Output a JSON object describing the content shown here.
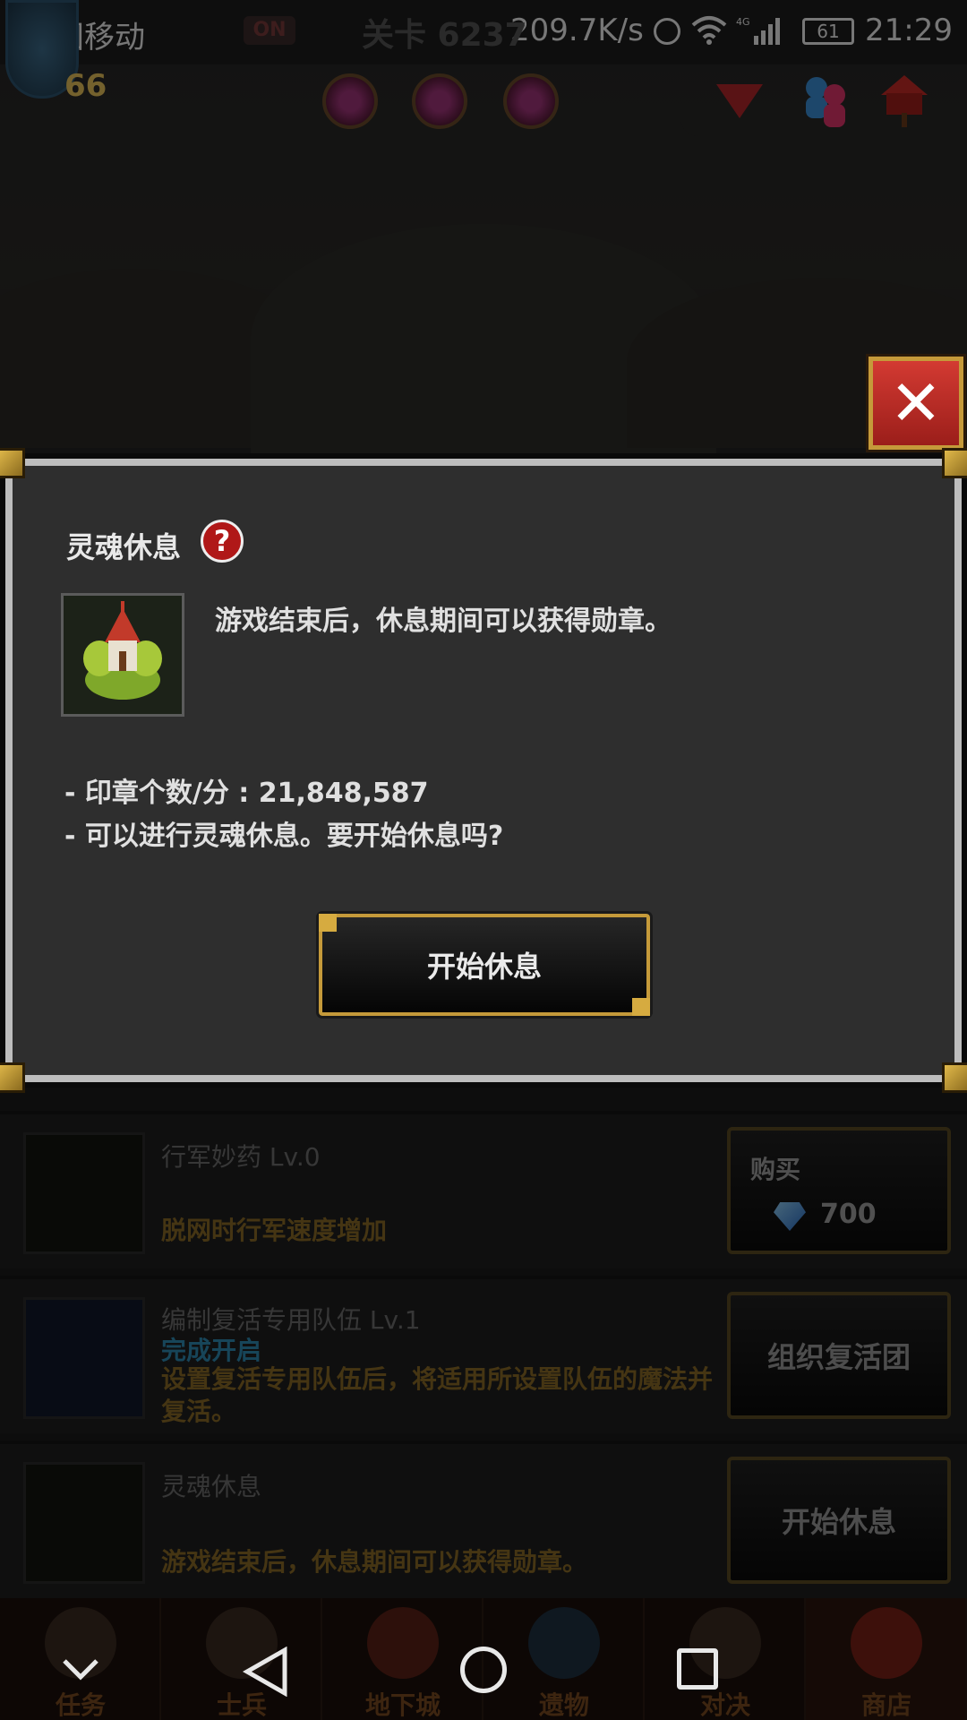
{
  "status_bar": {
    "carrier": "中国移动",
    "net_speed": "209.7K/s",
    "battery": "61",
    "time": "21:29",
    "icons": [
      "alarm-icon",
      "wifi-icon",
      "signal-4g-icon",
      "battery-icon"
    ]
  },
  "hud": {
    "player_level": "66",
    "toggle_label": "ON",
    "stage_label": "关卡 6237",
    "icons": [
      "avatar",
      "soul-orb-icon",
      "dropdown-icon",
      "friends-icon",
      "mailbox-icon"
    ]
  },
  "dialog": {
    "title": "灵魂休息",
    "help_label": "?",
    "description": "游戏结束后，休息期间可以获得勋章。",
    "info_lines": [
      "- 印章个数/分 : 21,848,587",
      "- 可以进行灵魂休息。要开始休息吗?"
    ],
    "start_button": "开始休息",
    "close_label": "✕"
  },
  "shop_items": [
    {
      "title": "行军妙药 Lv.0",
      "description": "脱网时行军速度增加",
      "button_label": "购买",
      "price": "700"
    },
    {
      "title": "编制复活专用队伍 Lv.1",
      "status": "完成开启",
      "description": "设置复活专用队伍后，将适用所设置队伍的魔法并复活。",
      "button_label": "组织复活团"
    },
    {
      "title": "灵魂休息",
      "description": "游戏结束后，休息期间可以获得勋章。",
      "button_label": "开始休息"
    }
  ],
  "tabs": [
    "任务",
    "士兵",
    "地下城",
    "遗物",
    "对决",
    "商店"
  ],
  "colors": {
    "accent_gold": "#c59a3a",
    "close_red": "#c62a26",
    "dialog_bg": "#2e2e2e",
    "desc_gold": "#8a6a26",
    "status_blue": "#2f8ab3"
  }
}
